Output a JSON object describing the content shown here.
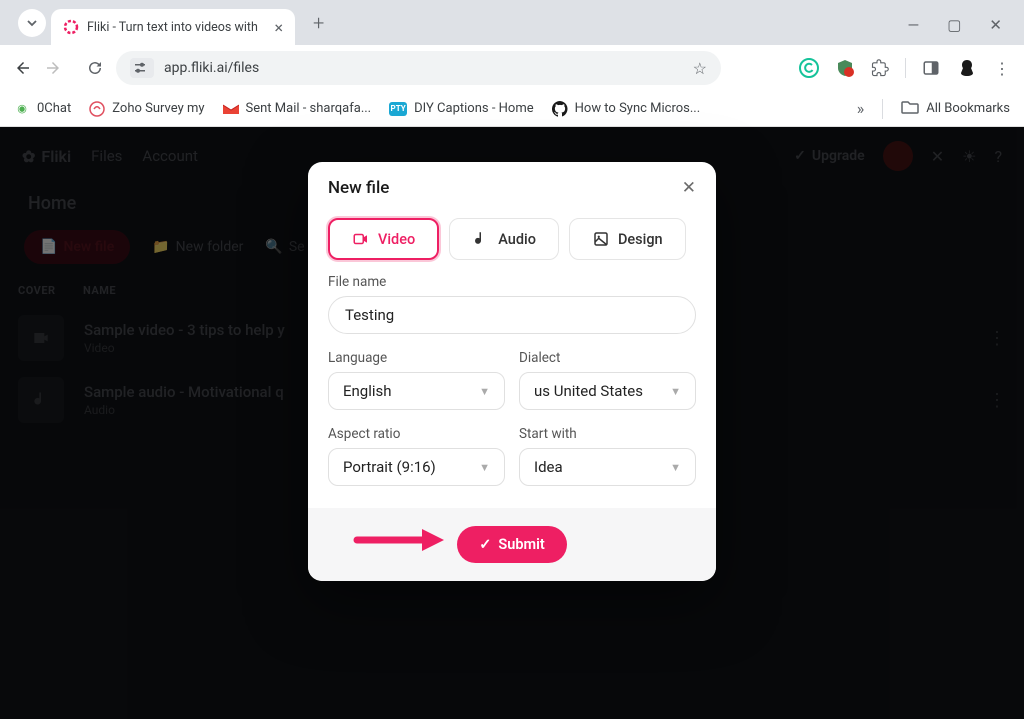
{
  "browser": {
    "tab_title": "Fliki - Turn text into videos with",
    "url": "app.fliki.ai/files",
    "bookmarks": [
      {
        "label": "0Chat"
      },
      {
        "label": "Zoho Survey my"
      },
      {
        "label": "Sent Mail - sharqafa..."
      },
      {
        "label": "DIY Captions - Home"
      },
      {
        "label": "How to Sync Micros..."
      }
    ],
    "all_bookmarks": "All Bookmarks"
  },
  "app": {
    "brand": "Fliki",
    "nav": {
      "files": "Files",
      "account": "Account"
    },
    "upgrade": "Upgrade",
    "page_title": "Home",
    "new_file": "New file",
    "new_folder": "New folder",
    "search_placeholder": "Se",
    "columns": {
      "cover": "COVER",
      "name": "NAME"
    },
    "files": [
      {
        "name": "Sample video - 3 tips to help y",
        "type": "Video"
      },
      {
        "name": "Sample audio - Motivational q",
        "type": "Audio"
      }
    ]
  },
  "modal": {
    "title": "New file",
    "tabs": {
      "video": "Video",
      "audio": "Audio",
      "design": "Design"
    },
    "file_name_label": "File name",
    "file_name_value": "Testing",
    "language_label": "Language",
    "language_value": "English",
    "dialect_label": "Dialect",
    "dialect_value": "us United States",
    "aspect_label": "Aspect ratio",
    "aspect_value": "Portrait (9:16)",
    "start_label": "Start with",
    "start_value": "Idea",
    "submit": "Submit"
  }
}
